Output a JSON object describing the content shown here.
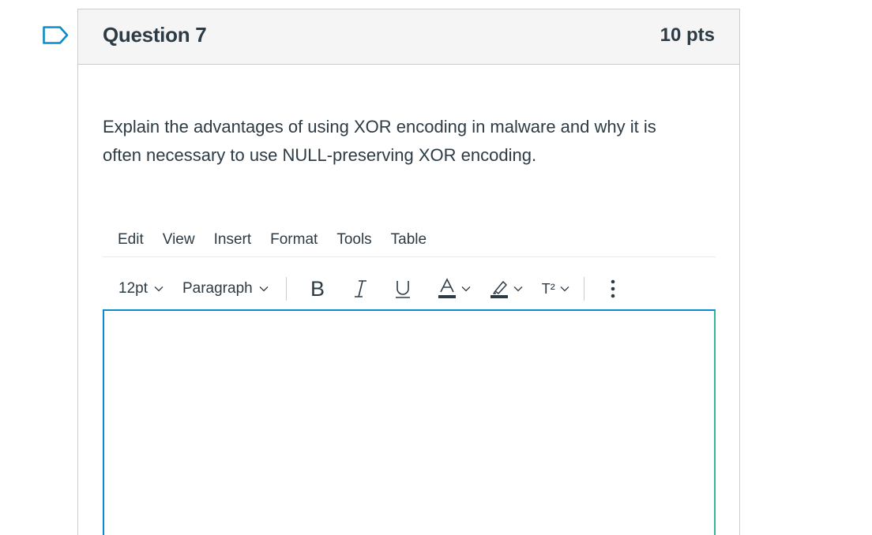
{
  "question": {
    "title": "Question 7",
    "points": "10 pts",
    "text_line1": "Explain the advantages of using XOR encoding in malware and why it is",
    "text_line2": "often necessary to use NULL-preserving XOR encoding.",
    "flag_icon": "flag-outline-icon"
  },
  "editor": {
    "menu": [
      "Edit",
      "View",
      "Insert",
      "Format",
      "Tools",
      "Table"
    ],
    "font_size": "12pt",
    "block_format": "Paragraph",
    "superscript_label": "T²",
    "content": ""
  },
  "colors": {
    "text": "#2d3b45",
    "header_bg": "#f5f5f5",
    "border": "#c7cdd1",
    "focus_border": "#0b8bc9",
    "flag": "#0b8bc9"
  }
}
